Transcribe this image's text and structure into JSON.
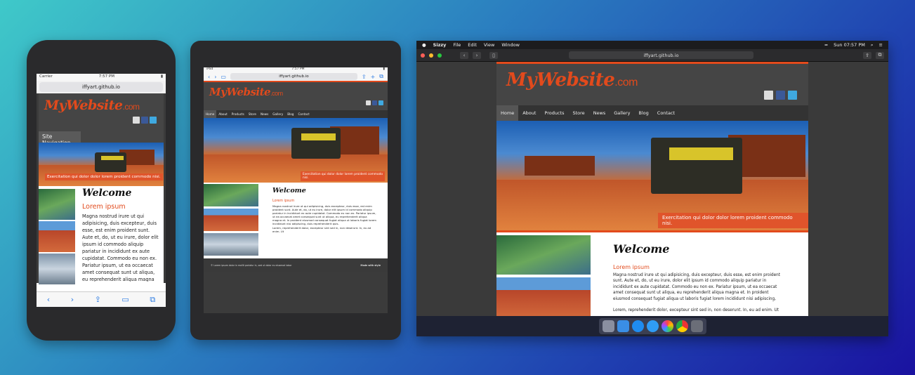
{
  "site": {
    "logo_my": "My",
    "logo_website": "Website",
    "logo_com": ".com",
    "url": "iffyart.github.io",
    "nav": [
      "Home",
      "About",
      "Products",
      "Store",
      "News",
      "Gallery",
      "Blog",
      "Contact"
    ],
    "site_navigation": "Site Navigation",
    "hero_caption": "Exercitation qui dolor dolor lorem proident commodo nisi.",
    "welcome": "Welcome",
    "lorem_heading": "Lorem ipsum",
    "para1": "Magna nostrud irure ut qui adipisicing, duis excepteur, duis esse, est enim proident sunt. Aute et, do, ut eu irure, dolor elit ipsum id commodo aliquip pariatur in incididunt ex aute cupidatat. Commodo eu non ex. Pariatur ipsum, ut ea occaecat amet consequat sunt ut aliqua, eu reprehenderit aliqua magna et. In proident eiusmod consequat fugiat aliqua ut laboris fugiat lorem incididunt nisi adipiscing, duis reprehenderit quis.",
    "para2": "Lorem, reprehenderit dolor, excepteur sint sed in, non deserunt. In, eu ad enim. Ut",
    "footer_left": "© Lorem ipsum dolor in mollit pariatur in, sed ut dolor eu eiusmod labor",
    "footer_right": "Made with style"
  },
  "phone": {
    "carrier": "Carrier",
    "time": "7:57 PM",
    "toolbar": [
      "‹",
      "›",
      "⇪",
      "▭",
      "⧉"
    ]
  },
  "tablet": {
    "time": "7:57 PM",
    "carrier": "iPad"
  },
  "desktop": {
    "menubar": [
      "Sizzy",
      "File",
      "Edit",
      "View",
      "Window"
    ],
    "clock": "Sun 07:57 PM"
  },
  "colors": {
    "accent": "#e24a1c",
    "facebook": "#3b5998",
    "twitter": "#3fa9e0"
  }
}
